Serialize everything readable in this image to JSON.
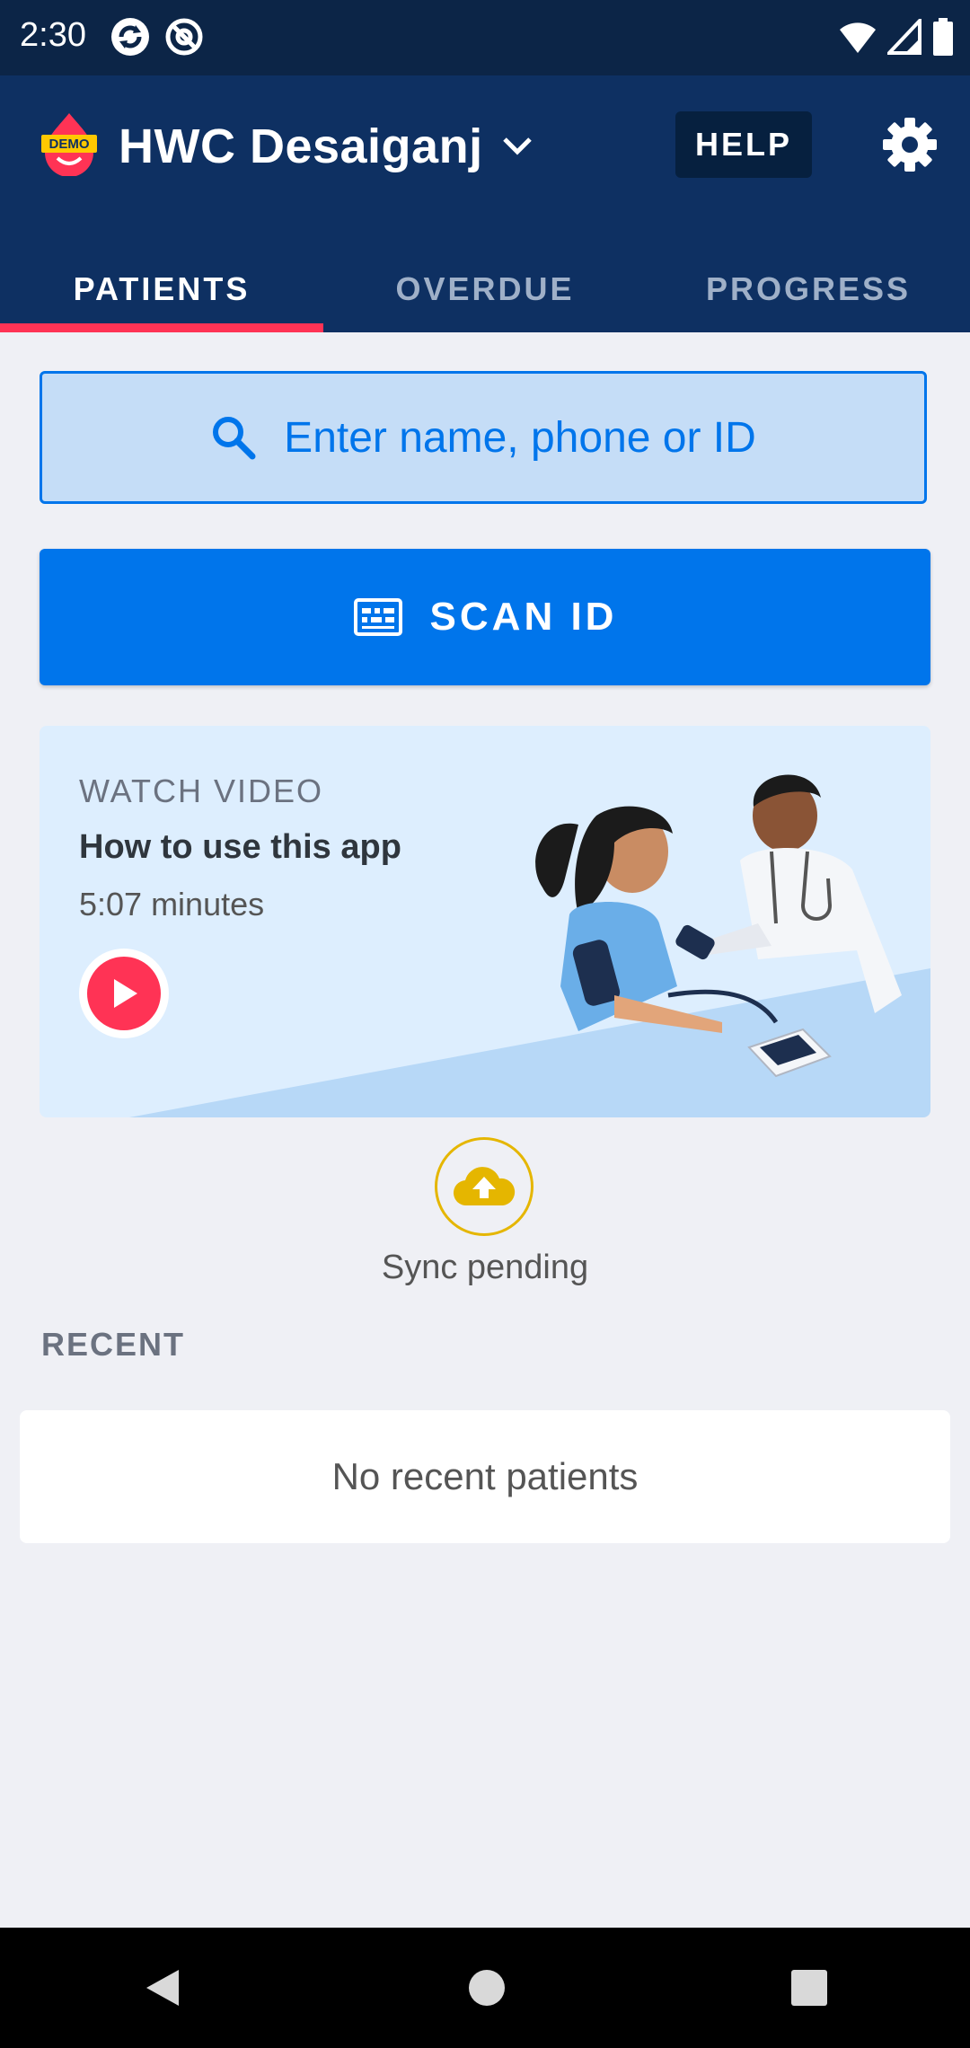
{
  "status_bar": {
    "time": "2:30",
    "icons_left": [
      "sync-icon",
      "at-sign-icon"
    ],
    "icons_right": [
      "wifi-icon",
      "signal-icon",
      "battery-icon"
    ]
  },
  "app_bar": {
    "logo_badge": "DEMO",
    "facility_name": "HWC Desaiganj",
    "help_label": "HELP",
    "settings_icon": "gear-icon"
  },
  "tabs": [
    {
      "label": "PATIENTS",
      "active": true
    },
    {
      "label": "OVERDUE",
      "active": false
    },
    {
      "label": "PROGRESS",
      "active": false
    }
  ],
  "search": {
    "placeholder": "Enter name, phone or ID",
    "icon": "search-icon"
  },
  "scan": {
    "label": "SCAN ID",
    "icon": "id-card-icon"
  },
  "video_card": {
    "kicker": "WATCH VIDEO",
    "title": "How to use this app",
    "duration": "5:07 minutes",
    "play_icon": "play-icon"
  },
  "sync": {
    "status": "Sync pending",
    "icon": "cloud-upload-icon"
  },
  "recent": {
    "label": "RECENT",
    "empty_text": "No recent patients"
  },
  "colors": {
    "status_bar": "#0c2547",
    "app_bar": "#0e3062",
    "accent_blue": "#0075eb",
    "tab_indicator": "#ff3355",
    "sync_yellow": "#e5b600",
    "background": "#eff0f5"
  }
}
